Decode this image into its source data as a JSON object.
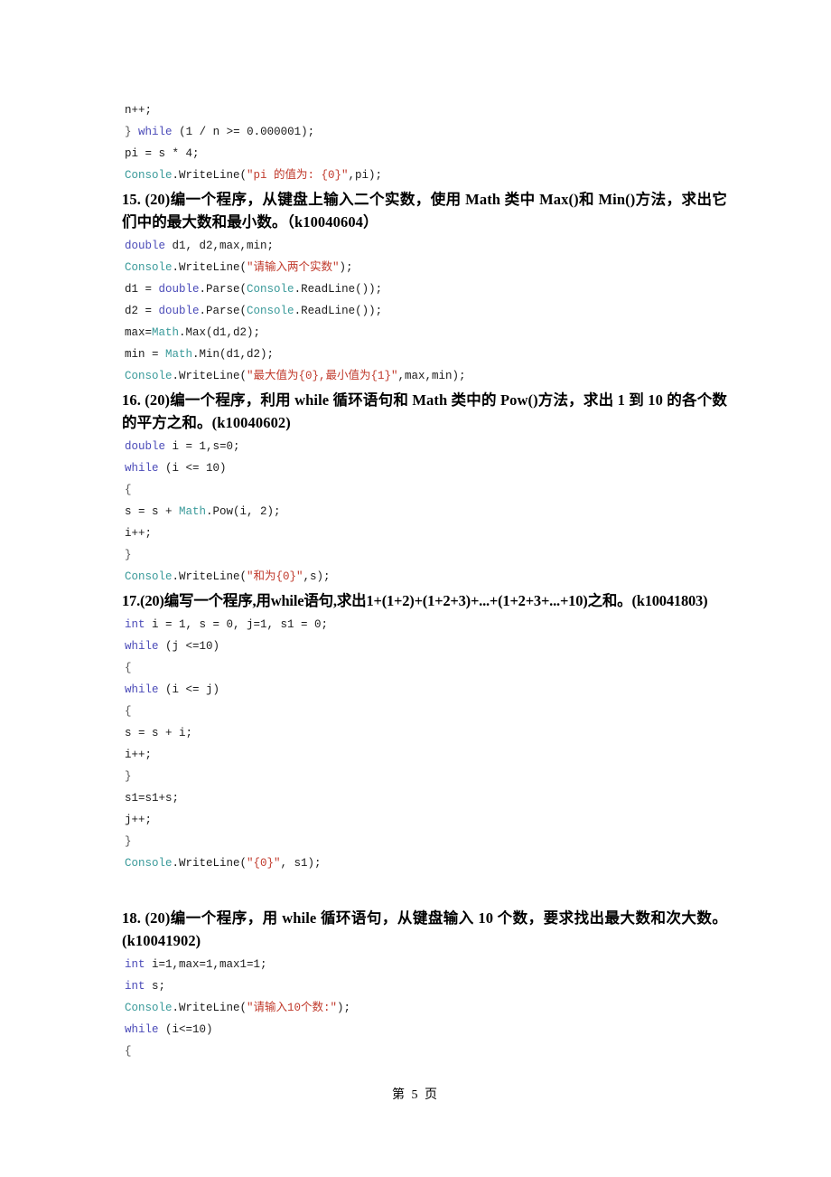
{
  "document": {
    "page_footer": "第 5 页",
    "page_number": 5
  },
  "blocks": [
    {
      "kind": "code",
      "id": "c14_1",
      "text": "n++;"
    },
    {
      "kind": "code",
      "id": "c14_2",
      "text": "} while (1 / n >= 0.000001);"
    },
    {
      "kind": "code",
      "id": "c14_3",
      "text": "pi = s * 4;"
    },
    {
      "kind": "code",
      "id": "c14_4",
      "text": "Console.WriteLine(\"pi 的值为: {0}\",pi);"
    },
    {
      "kind": "heading",
      "id": "q15",
      "number": "15.",
      "score": "(20)",
      "text": "15. (20)编一个程序，从键盘上输入二个实数，使用 Math 类中 Max()和 Min()方法，求出它们中的最大数和最小数。（k10040604）"
    },
    {
      "kind": "code",
      "id": "c15_1",
      "text": "double d1, d2,max,min;"
    },
    {
      "kind": "code",
      "id": "c15_2",
      "text": "Console.WriteLine(\"请输入两个实数\");"
    },
    {
      "kind": "code",
      "id": "c15_3",
      "text": "d1 = double.Parse(Console.ReadLine());"
    },
    {
      "kind": "code",
      "id": "c15_4",
      "text": "d2 = double.Parse(Console.ReadLine());"
    },
    {
      "kind": "code",
      "id": "c15_5",
      "text": "max=Math.Max(d1,d2);"
    },
    {
      "kind": "code",
      "id": "c15_6",
      "text": "min = Math.Min(d1,d2);"
    },
    {
      "kind": "code",
      "id": "c15_7",
      "text": "Console.WriteLine(\"最大值为{0},最小值为{1}\",max,min);"
    },
    {
      "kind": "heading",
      "id": "q16",
      "number": "16.",
      "score": "(20)",
      "text": "16. (20)编一个程序，利用 while 循环语句和 Math 类中的 Pow()方法，求出 1 到 10 的各个数的平方之和。(k10040602)"
    },
    {
      "kind": "code",
      "id": "c16_1",
      "text": "double i = 1,s=0;"
    },
    {
      "kind": "code",
      "id": "c16_2",
      "text": "while (i <= 10)"
    },
    {
      "kind": "code",
      "id": "c16_3",
      "text": "{"
    },
    {
      "kind": "code",
      "id": "c16_4",
      "text": "s = s + Math.Pow(i, 2);"
    },
    {
      "kind": "code",
      "id": "c16_5",
      "text": "i++;"
    },
    {
      "kind": "code",
      "id": "c16_6",
      "text": "}"
    },
    {
      "kind": "code",
      "id": "c16_7",
      "text": "Console.WriteLine(\"和为{0}\",s);"
    },
    {
      "kind": "heading",
      "id": "q17",
      "number": "17.",
      "score": "(20)",
      "text": "17.(20)编写一个程序,用while语句,求出1+(1+2)+(1+2+3)+...+(1+2+3+...+10)之和。(k10041803)"
    },
    {
      "kind": "code",
      "id": "c17_1",
      "text": "int i = 1, s = 0, j=1, s1 = 0;"
    },
    {
      "kind": "code",
      "id": "c17_2",
      "text": "while (j <=10)"
    },
    {
      "kind": "code",
      "id": "c17_3",
      "text": "{"
    },
    {
      "kind": "code",
      "id": "c17_4",
      "text": "while (i <= j)"
    },
    {
      "kind": "code",
      "id": "c17_5",
      "text": "{"
    },
    {
      "kind": "code",
      "id": "c17_6",
      "text": "s = s + i;"
    },
    {
      "kind": "code",
      "id": "c17_7",
      "text": "i++;"
    },
    {
      "kind": "code",
      "id": "c17_8",
      "text": "}"
    },
    {
      "kind": "code",
      "id": "c17_9",
      "text": "s1=s1+s;"
    },
    {
      "kind": "code",
      "id": "c17_10",
      "text": "j++;"
    },
    {
      "kind": "code",
      "id": "c17_11",
      "text": "}"
    },
    {
      "kind": "code",
      "id": "c17_12",
      "text": "Console.WriteLine(\"{0}\", s1);"
    },
    {
      "kind": "heading",
      "id": "q18",
      "number": "18.",
      "score": "(20)",
      "text": "18. (20)编一个程序，用 while 循环语句，从键盘输入 10 个数，要求找出最大数和次大数。(k10041902)"
    },
    {
      "kind": "code",
      "id": "c18_1",
      "text": "int i=1,max=1,max1=1;"
    },
    {
      "kind": "code",
      "id": "c18_2",
      "text": "int s;"
    },
    {
      "kind": "code",
      "id": "c18_3",
      "text": "Console.WriteLine(\"请输入10个数:\");"
    },
    {
      "kind": "code",
      "id": "c18_4",
      "text": "while (i<=10)"
    },
    {
      "kind": "code",
      "id": "c18_5",
      "text": "{"
    }
  ],
  "colors": {
    "keyword": "#4a4ab8",
    "class_name": "#3a9a9a",
    "string": "#c0392b",
    "plain": "#1a1a1a",
    "page_background": "#ffffff"
  }
}
